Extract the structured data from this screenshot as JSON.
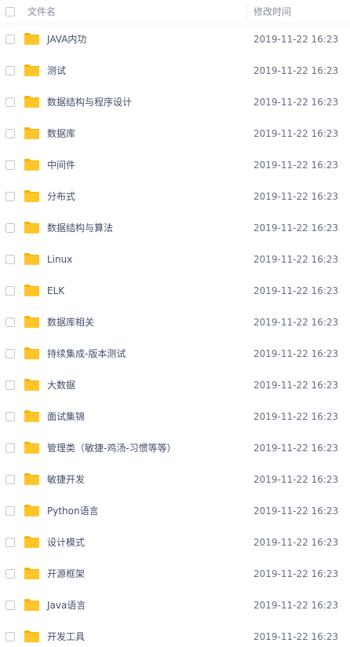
{
  "header": {
    "name_label": "文件名",
    "time_label": "修改时间"
  },
  "colors": {
    "folder": "#ffc52b",
    "folder_tab": "#f5b400"
  },
  "files": [
    {
      "name": "JAVA内功",
      "modified": "2019-11-22 16:23",
      "icon": "folder-icon"
    },
    {
      "name": "测试",
      "modified": "2019-11-22 16:23",
      "icon": "folder-icon"
    },
    {
      "name": "数据结构与程序设计",
      "modified": "2019-11-22 16:23",
      "icon": "folder-icon"
    },
    {
      "name": "数据库",
      "modified": "2019-11-22 16:23",
      "icon": "folder-icon"
    },
    {
      "name": "中间件",
      "modified": "2019-11-22 16:23",
      "icon": "folder-icon"
    },
    {
      "name": "分布式",
      "modified": "2019-11-22 16:23",
      "icon": "folder-icon"
    },
    {
      "name": "数据结构与算法",
      "modified": "2019-11-22 16:23",
      "icon": "folder-icon"
    },
    {
      "name": "Linux",
      "modified": "2019-11-22 16:23",
      "icon": "folder-icon"
    },
    {
      "name": "ELK",
      "modified": "2019-11-22 16:23",
      "icon": "folder-icon"
    },
    {
      "name": "数据库相关",
      "modified": "2019-11-22 16:23",
      "icon": "folder-icon"
    },
    {
      "name": "持续集成-版本测试",
      "modified": "2019-11-22 16:23",
      "icon": "folder-icon"
    },
    {
      "name": "大数据",
      "modified": "2019-11-22 16:23",
      "icon": "folder-icon"
    },
    {
      "name": "面试集锦",
      "modified": "2019-11-22 16:23",
      "icon": "folder-icon"
    },
    {
      "name": "管理类（敏捷-鸡汤-习惯等等）",
      "modified": "2019-11-22 16:23",
      "icon": "folder-icon"
    },
    {
      "name": "敏捷开发",
      "modified": "2019-11-22 16:23",
      "icon": "folder-icon"
    },
    {
      "name": "Python语言",
      "modified": "2019-11-22 16:23",
      "icon": "folder-icon"
    },
    {
      "name": "设计模式",
      "modified": "2019-11-22 16:23",
      "icon": "folder-icon"
    },
    {
      "name": "开源框架",
      "modified": "2019-11-22 16:23",
      "icon": "folder-icon"
    },
    {
      "name": "Java语言",
      "modified": "2019-11-22 16:23",
      "icon": "folder-icon"
    },
    {
      "name": "开发工具",
      "modified": "2019-11-22 16:23",
      "icon": "folder-icon"
    }
  ]
}
